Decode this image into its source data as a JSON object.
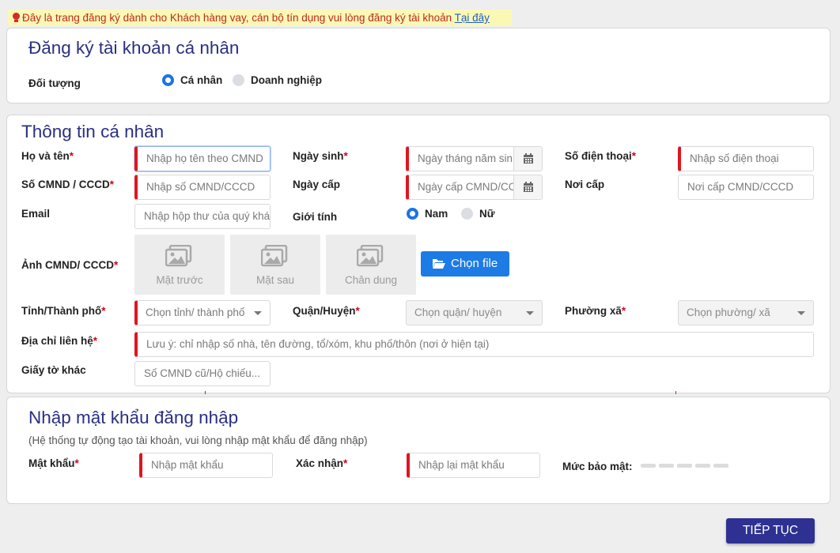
{
  "notice": {
    "text": "Đây là trang đăng ký dành cho Khách hàng vay, cán bộ tín dụng vui lòng đăng ký tài khoản ",
    "link": "Tại đây"
  },
  "account_type": {
    "title": "Đăng ký tài khoản cá nhân",
    "label": "Đối tượng",
    "options": [
      {
        "label": "Cá nhân",
        "selected": true
      },
      {
        "label": "Doanh nghiệp",
        "selected": false
      }
    ]
  },
  "personal": {
    "title": "Thông tin cá nhân",
    "full_name": {
      "label": "Họ và tên",
      "placeholder": "Nhập họ tên theo CMND"
    },
    "dob": {
      "label": "Ngày sinh",
      "placeholder": "Ngày tháng năm sinh"
    },
    "phone": {
      "label": "Số điện thoại",
      "placeholder": "Nhập số điện thoại"
    },
    "id_number": {
      "label": "Số CMND / CCCD",
      "placeholder": "Nhập số CMND/CCCD"
    },
    "issue_date": {
      "label": "Ngày cấp",
      "placeholder": "Ngày cấp CMND/CCCD"
    },
    "issue_place": {
      "label": "Nơi cấp",
      "placeholder": "Nơi cấp CMND/CCCD"
    },
    "email": {
      "label": "Email",
      "placeholder": "Nhập hộp thư của quý khách"
    },
    "gender": {
      "label": "Giới tính",
      "options": [
        {
          "label": "Nam",
          "selected": true
        },
        {
          "label": "Nữ",
          "selected": false
        }
      ]
    },
    "id_photo": {
      "label": "Ảnh CMND/ CCCD",
      "tiles": [
        "Mặt trước",
        "Mặt sau",
        "Chân dung"
      ],
      "button": "Chọn file"
    },
    "province": {
      "label": "Tỉnh/Thành phố",
      "placeholder": "Chọn tỉnh/ thành phố"
    },
    "district": {
      "label": "Quận/Huyện",
      "placeholder": "Chọn quận/ huyện"
    },
    "ward": {
      "label": "Phường xã",
      "placeholder": "Chọn phường/ xã"
    },
    "address": {
      "label": "Địa chỉ liên hệ",
      "placeholder": "Lưu ý: chỉ nhập số nhà, tên đường, tổ/xóm, khu phố/thôn (nơi ở hiện tại)"
    },
    "other_docs": {
      "label": "Giấy tờ khác",
      "placeholder": "Số CMND cũ/Hộ chiếu..."
    },
    "required_mark": "*"
  },
  "password": {
    "title": "Nhập mật khẩu đăng nhập",
    "subtitle": "(Hệ thống tự động tạo tài khoản, vui lòng nhập mật khẩu để đăng nhập)",
    "password": {
      "label": "Mật khẩu",
      "placeholder": "Nhập mật khẩu"
    },
    "confirm": {
      "label": "Xác nhận",
      "placeholder": "Nhập lại mật khẩu"
    },
    "strength_label": "Mức bảo mật:"
  },
  "submit_label": "TIẾP TỤC",
  "colors": {
    "title": "#2a2f82",
    "accent": "#1b73e8",
    "required": "#e0151f",
    "notice_bg": "#fbf8b6",
    "submit_bg": "#2e3192"
  }
}
